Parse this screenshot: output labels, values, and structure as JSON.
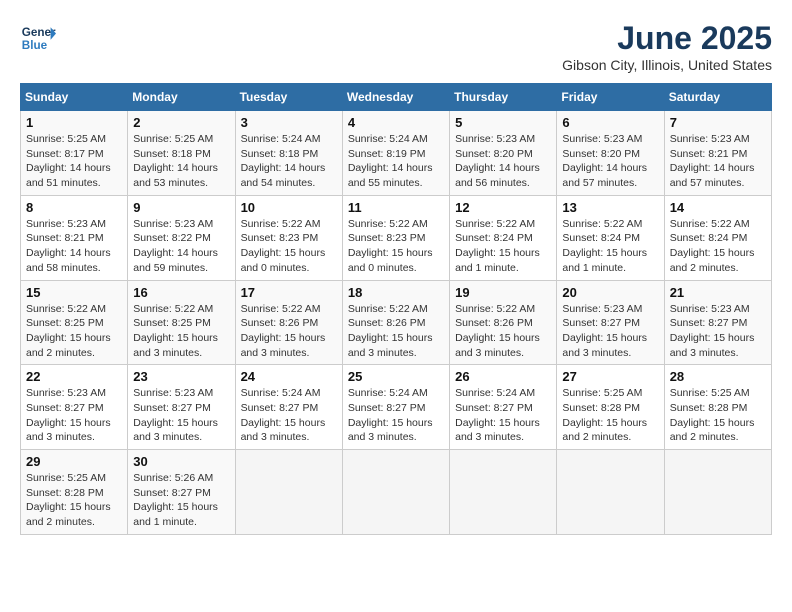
{
  "header": {
    "logo_line1": "General",
    "logo_line2": "Blue",
    "month": "June 2025",
    "location": "Gibson City, Illinois, United States"
  },
  "weekdays": [
    "Sunday",
    "Monday",
    "Tuesday",
    "Wednesday",
    "Thursday",
    "Friday",
    "Saturday"
  ],
  "weeks": [
    [
      {
        "day": "1",
        "info": "Sunrise: 5:25 AM\nSunset: 8:17 PM\nDaylight: 14 hours\nand 51 minutes."
      },
      {
        "day": "2",
        "info": "Sunrise: 5:25 AM\nSunset: 8:18 PM\nDaylight: 14 hours\nand 53 minutes."
      },
      {
        "day": "3",
        "info": "Sunrise: 5:24 AM\nSunset: 8:18 PM\nDaylight: 14 hours\nand 54 minutes."
      },
      {
        "day": "4",
        "info": "Sunrise: 5:24 AM\nSunset: 8:19 PM\nDaylight: 14 hours\nand 55 minutes."
      },
      {
        "day": "5",
        "info": "Sunrise: 5:23 AM\nSunset: 8:20 PM\nDaylight: 14 hours\nand 56 minutes."
      },
      {
        "day": "6",
        "info": "Sunrise: 5:23 AM\nSunset: 8:20 PM\nDaylight: 14 hours\nand 57 minutes."
      },
      {
        "day": "7",
        "info": "Sunrise: 5:23 AM\nSunset: 8:21 PM\nDaylight: 14 hours\nand 57 minutes."
      }
    ],
    [
      {
        "day": "8",
        "info": "Sunrise: 5:23 AM\nSunset: 8:21 PM\nDaylight: 14 hours\nand 58 minutes."
      },
      {
        "day": "9",
        "info": "Sunrise: 5:23 AM\nSunset: 8:22 PM\nDaylight: 14 hours\nand 59 minutes."
      },
      {
        "day": "10",
        "info": "Sunrise: 5:22 AM\nSunset: 8:23 PM\nDaylight: 15 hours\nand 0 minutes."
      },
      {
        "day": "11",
        "info": "Sunrise: 5:22 AM\nSunset: 8:23 PM\nDaylight: 15 hours\nand 0 minutes."
      },
      {
        "day": "12",
        "info": "Sunrise: 5:22 AM\nSunset: 8:24 PM\nDaylight: 15 hours\nand 1 minute."
      },
      {
        "day": "13",
        "info": "Sunrise: 5:22 AM\nSunset: 8:24 PM\nDaylight: 15 hours\nand 1 minute."
      },
      {
        "day": "14",
        "info": "Sunrise: 5:22 AM\nSunset: 8:24 PM\nDaylight: 15 hours\nand 2 minutes."
      }
    ],
    [
      {
        "day": "15",
        "info": "Sunrise: 5:22 AM\nSunset: 8:25 PM\nDaylight: 15 hours\nand 2 minutes."
      },
      {
        "day": "16",
        "info": "Sunrise: 5:22 AM\nSunset: 8:25 PM\nDaylight: 15 hours\nand 3 minutes."
      },
      {
        "day": "17",
        "info": "Sunrise: 5:22 AM\nSunset: 8:26 PM\nDaylight: 15 hours\nand 3 minutes."
      },
      {
        "day": "18",
        "info": "Sunrise: 5:22 AM\nSunset: 8:26 PM\nDaylight: 15 hours\nand 3 minutes."
      },
      {
        "day": "19",
        "info": "Sunrise: 5:22 AM\nSunset: 8:26 PM\nDaylight: 15 hours\nand 3 minutes."
      },
      {
        "day": "20",
        "info": "Sunrise: 5:23 AM\nSunset: 8:27 PM\nDaylight: 15 hours\nand 3 minutes."
      },
      {
        "day": "21",
        "info": "Sunrise: 5:23 AM\nSunset: 8:27 PM\nDaylight: 15 hours\nand 3 minutes."
      }
    ],
    [
      {
        "day": "22",
        "info": "Sunrise: 5:23 AM\nSunset: 8:27 PM\nDaylight: 15 hours\nand 3 minutes."
      },
      {
        "day": "23",
        "info": "Sunrise: 5:23 AM\nSunset: 8:27 PM\nDaylight: 15 hours\nand 3 minutes."
      },
      {
        "day": "24",
        "info": "Sunrise: 5:24 AM\nSunset: 8:27 PM\nDaylight: 15 hours\nand 3 minutes."
      },
      {
        "day": "25",
        "info": "Sunrise: 5:24 AM\nSunset: 8:27 PM\nDaylight: 15 hours\nand 3 minutes."
      },
      {
        "day": "26",
        "info": "Sunrise: 5:24 AM\nSunset: 8:27 PM\nDaylight: 15 hours\nand 3 minutes."
      },
      {
        "day": "27",
        "info": "Sunrise: 5:25 AM\nSunset: 8:28 PM\nDaylight: 15 hours\nand 2 minutes."
      },
      {
        "day": "28",
        "info": "Sunrise: 5:25 AM\nSunset: 8:28 PM\nDaylight: 15 hours\nand 2 minutes."
      }
    ],
    [
      {
        "day": "29",
        "info": "Sunrise: 5:25 AM\nSunset: 8:28 PM\nDaylight: 15 hours\nand 2 minutes."
      },
      {
        "day": "30",
        "info": "Sunrise: 5:26 AM\nSunset: 8:27 PM\nDaylight: 15 hours\nand 1 minute."
      },
      {
        "day": "",
        "info": ""
      },
      {
        "day": "",
        "info": ""
      },
      {
        "day": "",
        "info": ""
      },
      {
        "day": "",
        "info": ""
      },
      {
        "day": "",
        "info": ""
      }
    ]
  ]
}
